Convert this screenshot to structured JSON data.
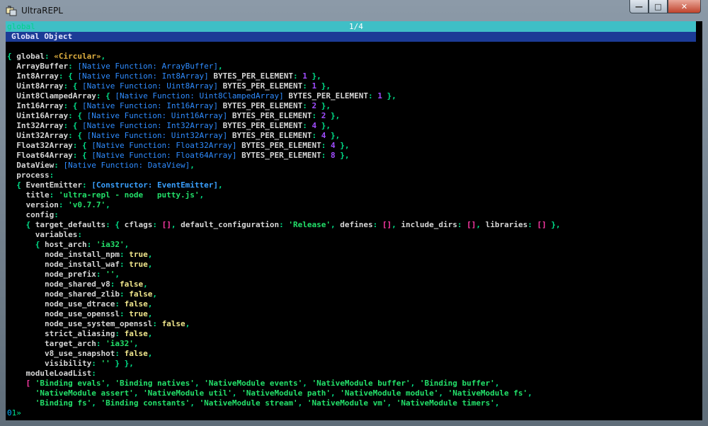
{
  "window": {
    "title": "UltraREPL",
    "icon": "ultrarepl-app-icon"
  },
  "controls": {
    "minimize": "—",
    "maximize": "□",
    "close": "✕"
  },
  "tab": {
    "name": "global",
    "page": "1/4"
  },
  "header": {
    "title": "Global Object"
  },
  "colors": {
    "titlebar": "#8c9aa8",
    "console_bg": "#000000",
    "tabbar": "#3fbfc6",
    "headerbar": "#1c3b96",
    "key": "#d6d6d6",
    "punct": "#00e08a",
    "function": "#2f8cff",
    "string": "#23e06a",
    "number": "#a04dff",
    "boolean": "#f0e68c",
    "circular": "#e0b040",
    "empty_array": "#ff3aa8"
  },
  "output": [
    [
      [
        "p",
        "{ "
      ],
      [
        "k",
        "global"
      ],
      [
        "p",
        ": "
      ],
      [
        "c",
        "«Circular»"
      ],
      [
        "p",
        ","
      ]
    ],
    [
      [
        "k",
        "  ArrayBuffer"
      ],
      [
        "p",
        ": "
      ],
      [
        "f",
        "[Native Function: ArrayBuffer]"
      ],
      [
        "p",
        ","
      ]
    ],
    [
      [
        "k",
        "  Int8Array"
      ],
      [
        "p",
        ": { "
      ],
      [
        "f",
        "[Native Function: Int8Array]"
      ],
      [
        "k",
        " BYTES_PER_ELEMENT"
      ],
      [
        "p",
        ": "
      ],
      [
        "n",
        "1"
      ],
      [
        "p",
        " },"
      ]
    ],
    [
      [
        "k",
        "  Uint8Array"
      ],
      [
        "p",
        ": { "
      ],
      [
        "f",
        "[Native Function: Uint8Array]"
      ],
      [
        "k",
        " BYTES_PER_ELEMENT"
      ],
      [
        "p",
        ": "
      ],
      [
        "n",
        "1"
      ],
      [
        "p",
        " },"
      ]
    ],
    [
      [
        "k",
        "  Uint8ClampedArray"
      ],
      [
        "p",
        ": { "
      ],
      [
        "f",
        "[Native Function: Uint8ClampedArray]"
      ],
      [
        "k",
        " BYTES_PER_ELEMENT"
      ],
      [
        "p",
        ": "
      ],
      [
        "n",
        "1"
      ],
      [
        "p",
        " },"
      ]
    ],
    [
      [
        "k",
        "  Int16Array"
      ],
      [
        "p",
        ": { "
      ],
      [
        "f",
        "[Native Function: Int16Array]"
      ],
      [
        "k",
        " BYTES_PER_ELEMENT"
      ],
      [
        "p",
        ": "
      ],
      [
        "n",
        "2"
      ],
      [
        "p",
        " },"
      ]
    ],
    [
      [
        "k",
        "  Uint16Array"
      ],
      [
        "p",
        ": { "
      ],
      [
        "f",
        "[Native Function: Uint16Array]"
      ],
      [
        "k",
        " BYTES_PER_ELEMENT"
      ],
      [
        "p",
        ": "
      ],
      [
        "n",
        "2"
      ],
      [
        "p",
        " },"
      ]
    ],
    [
      [
        "k",
        "  Int32Array"
      ],
      [
        "p",
        ": { "
      ],
      [
        "f",
        "[Native Function: Int32Array]"
      ],
      [
        "k",
        " BYTES_PER_ELEMENT"
      ],
      [
        "p",
        ": "
      ],
      [
        "n",
        "4"
      ],
      [
        "p",
        " },"
      ]
    ],
    [
      [
        "k",
        "  Uint32Array"
      ],
      [
        "p",
        ": { "
      ],
      [
        "f",
        "[Native Function: Uint32Array]"
      ],
      [
        "k",
        " BYTES_PER_ELEMENT"
      ],
      [
        "p",
        ": "
      ],
      [
        "n",
        "4"
      ],
      [
        "p",
        " },"
      ]
    ],
    [
      [
        "k",
        "  Float32Array"
      ],
      [
        "p",
        ": { "
      ],
      [
        "f",
        "[Native Function: Float32Array]"
      ],
      [
        "k",
        " BYTES_PER_ELEMENT"
      ],
      [
        "p",
        ": "
      ],
      [
        "n",
        "4"
      ],
      [
        "p",
        " },"
      ]
    ],
    [
      [
        "k",
        "  Float64Array"
      ],
      [
        "p",
        ": { "
      ],
      [
        "f",
        "[Native Function: Float64Array]"
      ],
      [
        "k",
        " BYTES_PER_ELEMENT"
      ],
      [
        "p",
        ": "
      ],
      [
        "n",
        "8"
      ],
      [
        "p",
        " },"
      ]
    ],
    [
      [
        "k",
        "  DataView"
      ],
      [
        "p",
        ": "
      ],
      [
        "f",
        "[Native Function: DataView]"
      ],
      [
        "p",
        ","
      ]
    ],
    [
      [
        "k",
        "  process"
      ],
      [
        "p",
        ":"
      ]
    ],
    [
      [
        "p",
        "  { "
      ],
      [
        "k",
        "EventEmitter"
      ],
      [
        "p",
        ": "
      ],
      [
        "ce",
        "[Constructor: EventEmitter]"
      ],
      [
        "p",
        ","
      ]
    ],
    [
      [
        "k",
        "    title"
      ],
      [
        "p",
        ": "
      ],
      [
        "s",
        "'ultra-repl - node   putty.js'"
      ],
      [
        "p",
        ","
      ]
    ],
    [
      [
        "k",
        "    version"
      ],
      [
        "p",
        ": "
      ],
      [
        "s",
        "'v0.7.7'"
      ],
      [
        "p",
        ","
      ]
    ],
    [
      [
        "k",
        "    config"
      ],
      [
        "p",
        ":"
      ]
    ],
    [
      [
        "p",
        "    { "
      ],
      [
        "k",
        "target_defaults"
      ],
      [
        "p",
        ": { "
      ],
      [
        "k",
        "cflags"
      ],
      [
        "p",
        ": "
      ],
      [
        "pk",
        "[]"
      ],
      [
        "p",
        ", "
      ],
      [
        "k",
        "default_configuration"
      ],
      [
        "p",
        ": "
      ],
      [
        "s",
        "'Release'"
      ],
      [
        "p",
        ", "
      ],
      [
        "k",
        "defines"
      ],
      [
        "p",
        ": "
      ],
      [
        "pk",
        "[]"
      ],
      [
        "p",
        ", "
      ],
      [
        "k",
        "include_dirs"
      ],
      [
        "p",
        ": "
      ],
      [
        "pk",
        "[]"
      ],
      [
        "p",
        ", "
      ],
      [
        "k",
        "libraries"
      ],
      [
        "p",
        ": "
      ],
      [
        "pk",
        "[]"
      ],
      [
        "p",
        " },"
      ]
    ],
    [
      [
        "k",
        "      variables"
      ],
      [
        "p",
        ":"
      ]
    ],
    [
      [
        "p",
        "      { "
      ],
      [
        "k",
        "host_arch"
      ],
      [
        "p",
        ": "
      ],
      [
        "s",
        "'ia32'"
      ],
      [
        "p",
        ","
      ]
    ],
    [
      [
        "k",
        "        node_install_npm"
      ],
      [
        "p",
        ": "
      ],
      [
        "b",
        "true"
      ],
      [
        "p",
        ","
      ]
    ],
    [
      [
        "k",
        "        node_install_waf"
      ],
      [
        "p",
        ": "
      ],
      [
        "b",
        "true"
      ],
      [
        "p",
        ","
      ]
    ],
    [
      [
        "k",
        "        node_prefix"
      ],
      [
        "p",
        ": "
      ],
      [
        "s",
        "''"
      ],
      [
        "p",
        ","
      ]
    ],
    [
      [
        "k",
        "        node_shared_v8"
      ],
      [
        "p",
        ": "
      ],
      [
        "b",
        "false"
      ],
      [
        "p",
        ","
      ]
    ],
    [
      [
        "k",
        "        node_shared_zlib"
      ],
      [
        "p",
        ": "
      ],
      [
        "b",
        "false"
      ],
      [
        "p",
        ","
      ]
    ],
    [
      [
        "k",
        "        node_use_dtrace"
      ],
      [
        "p",
        ": "
      ],
      [
        "b",
        "false"
      ],
      [
        "p",
        ","
      ]
    ],
    [
      [
        "k",
        "        node_use_openssl"
      ],
      [
        "p",
        ": "
      ],
      [
        "b",
        "true"
      ],
      [
        "p",
        ","
      ]
    ],
    [
      [
        "k",
        "        node_use_system_openssl"
      ],
      [
        "p",
        ": "
      ],
      [
        "b",
        "false"
      ],
      [
        "p",
        ","
      ]
    ],
    [
      [
        "k",
        "        strict_aliasing"
      ],
      [
        "p",
        ": "
      ],
      [
        "b",
        "false"
      ],
      [
        "p",
        ","
      ]
    ],
    [
      [
        "k",
        "        target_arch"
      ],
      [
        "p",
        ": "
      ],
      [
        "s",
        "'ia32'"
      ],
      [
        "p",
        ","
      ]
    ],
    [
      [
        "k",
        "        v8_use_snapshot"
      ],
      [
        "p",
        ": "
      ],
      [
        "b",
        "false"
      ],
      [
        "p",
        ","
      ]
    ],
    [
      [
        "k",
        "        visibility"
      ],
      [
        "p",
        ": "
      ],
      [
        "s",
        "''"
      ],
      [
        "p",
        " } },"
      ]
    ],
    [
      [
        "k",
        "    moduleLoadList"
      ],
      [
        "p",
        ":"
      ]
    ],
    [
      [
        "pk",
        "    [ "
      ],
      [
        "s",
        "'Binding evals'"
      ],
      [
        "p",
        ", "
      ],
      [
        "s",
        "'Binding natives'"
      ],
      [
        "p",
        ", "
      ],
      [
        "s",
        "'NativeModule events'"
      ],
      [
        "p",
        ", "
      ],
      [
        "s",
        "'NativeModule buffer'"
      ],
      [
        "p",
        ", "
      ],
      [
        "s",
        "'Binding buffer'"
      ],
      [
        "p",
        ","
      ]
    ],
    [
      [
        "s",
        "      'NativeModule assert'"
      ],
      [
        "p",
        ", "
      ],
      [
        "s",
        "'NativeModule util'"
      ],
      [
        "p",
        ", "
      ],
      [
        "s",
        "'NativeModule path'"
      ],
      [
        "p",
        ", "
      ],
      [
        "s",
        "'NativeModule module'"
      ],
      [
        "p",
        ", "
      ],
      [
        "s",
        "'NativeModule fs'"
      ],
      [
        "p",
        ","
      ]
    ],
    [
      [
        "s",
        "      'Binding fs'"
      ],
      [
        "p",
        ", "
      ],
      [
        "s",
        "'Binding constants'"
      ],
      [
        "p",
        ", "
      ],
      [
        "s",
        "'NativeModule stream'"
      ],
      [
        "p",
        ", "
      ],
      [
        "s",
        "'NativeModule vm'"
      ],
      [
        "p",
        ", "
      ],
      [
        "s",
        "'NativeModule timers'"
      ],
      [
        "p",
        ","
      ]
    ]
  ],
  "prompt": {
    "index": "0",
    "number": "1",
    "symbol": "»"
  }
}
